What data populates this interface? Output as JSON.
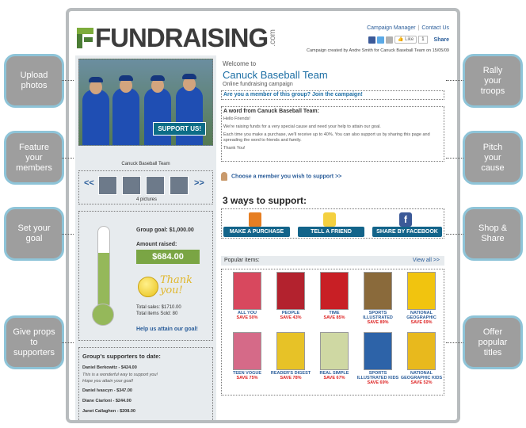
{
  "header": {
    "logo_text": "FUNDRAISING",
    "logo_suffix": ".com",
    "links": [
      "Campaign Manager",
      "Contact Us"
    ],
    "like_label": "Like",
    "like_count": "1",
    "share_label": "Share",
    "created_by": "Campaign created by Andre Smith for Canuck Baseball Team on 15/05/09"
  },
  "left": {
    "support_button": "SUPPORT US!",
    "team_caption": "Canuck Baseball Team",
    "pictures_count": "4 pictures",
    "prev_arrow": "<<",
    "next_arrow": ">>",
    "goal_label": "Group goal: $1,000.00",
    "raised_label": "Amount  raised:",
    "raised_value": "$684.00",
    "progress_fraction": 0.684,
    "thank_you": "Thank you!",
    "total_sales": "Total sales: $1710.00",
    "total_items": "Total items Sold:  80",
    "help_text": "Help us attain our goal!",
    "supporters_heading": "Group's supporters to date:",
    "supporters": [
      {
        "name": "Daniel Berkowitz - $424.00",
        "message": [
          "This is a wonderful way to support you!",
          "Hope you attain your goal!"
        ]
      },
      {
        "name": "Daniel Ivascyn - $347.00",
        "message": []
      },
      {
        "name": "Diane Ciarloni - $244.00",
        "message": []
      },
      {
        "name": "Janet Callaghen - $208.00",
        "message": []
      }
    ]
  },
  "main": {
    "welcome": "Welcome to",
    "team_name": "Canuck Baseball Team",
    "subtitle": "Online fundraising campaign",
    "join_text": "Are you a member of this group? Join the campaign!",
    "word_heading": "A word from Canuck Baseball Team:",
    "word_paragraphs": [
      "Hello Friends!",
      "We're raising funds for a very special cause and need your help to attain our goal.",
      "Each time you make a purchase, we'll receive up to 40%. You can also support us by sharing this page and spreading the word to friends and family.",
      "Thank You!"
    ],
    "choose_member": "Choose a member you wish to support >>",
    "ways_heading": "3 ways to support:",
    "ways": [
      "MAKE A PURCHASE",
      "TELL A FRIEND",
      "SHARE BY FACEBOOK"
    ],
    "popular_label": "Popular items:",
    "view_all": "View all >>",
    "magazines": [
      {
        "title": "ALL YOU",
        "save": "SAVE 50%",
        "color": "#d8485e"
      },
      {
        "title": "PEOPLE",
        "save": "SAVE 43%",
        "color": "#b3222e"
      },
      {
        "title": "TIME",
        "save": "SAVE 85%",
        "color": "#c81f25"
      },
      {
        "title": "SPORTS ILLUSTRATED",
        "save": "SAVE 89%",
        "color": "#8a6a3b"
      },
      {
        "title": "NATIONAL GEOGRAPHIC",
        "save": "SAVE 69%",
        "color": "#f1c40f"
      },
      {
        "title": "TEEN VOGUE",
        "save": "SAVE 75%",
        "color": "#d56a88"
      },
      {
        "title": "READER'S DIGEST",
        "save": "SAVE 78%",
        "color": "#e7c227"
      },
      {
        "title": "REAL SIMPLE",
        "save": "SAVE 67%",
        "color": "#cfd8a3"
      },
      {
        "title": "SPORTS ILLUSTRATED KIDS",
        "save": "SAVE 69%",
        "color": "#2d63a8"
      },
      {
        "title": "NATIONAL GEOGRAPHIC KIDS",
        "save": "SAVE 52%",
        "color": "#e8b91d"
      }
    ]
  },
  "callouts": {
    "left": [
      "Upload photos",
      "Feature your members",
      "Set your goal",
      "Give props to supporters"
    ],
    "right": [
      "Rally your troops",
      "Pitch your cause",
      "Shop & Share",
      "Offer popular titles"
    ]
  },
  "colors": {
    "accent": "#1c6ea4",
    "button": "#13648a",
    "green": "#7aa544",
    "bubble": "#9e9e9e",
    "bubble_border": "#8ec4d8"
  }
}
